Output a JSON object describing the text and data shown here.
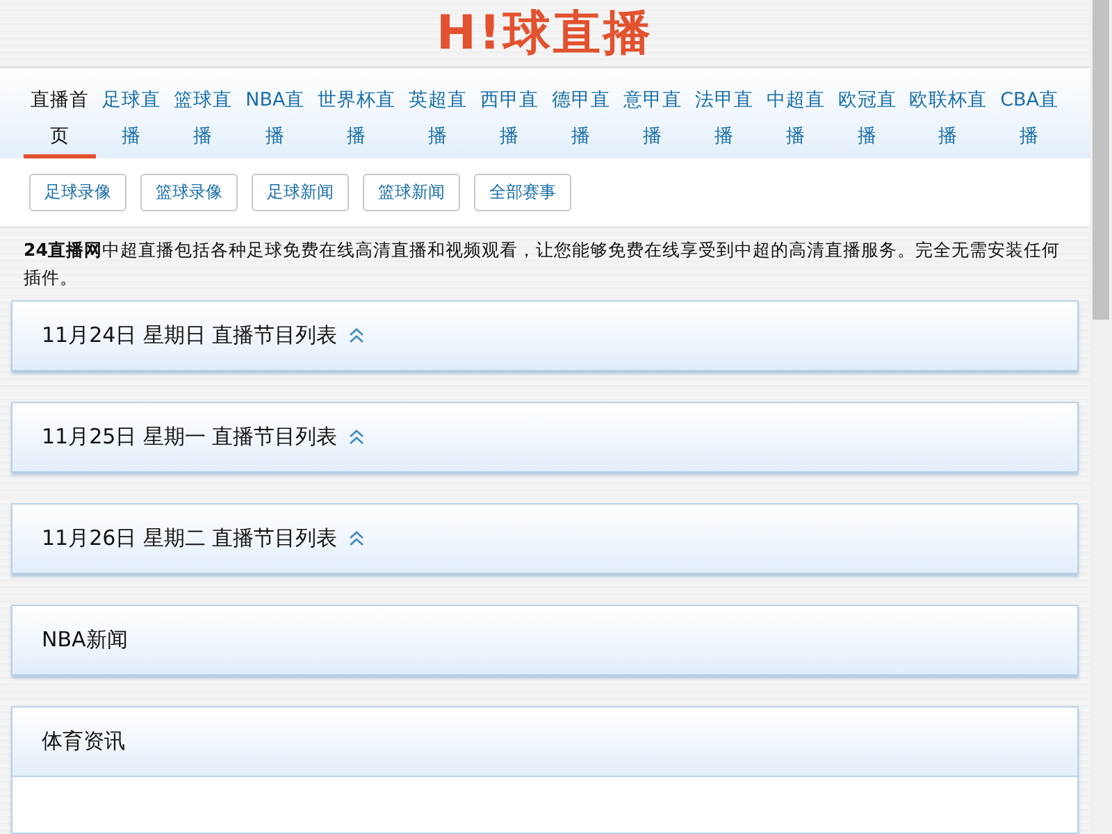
{
  "logo": "H!球直播",
  "nav": [
    {
      "label": "直播首页",
      "selected": true
    },
    {
      "label": "足球直播",
      "selected": false
    },
    {
      "label": "篮球直播",
      "selected": false
    },
    {
      "label": "NBA直播",
      "selected": false
    },
    {
      "label": "世界杯直播",
      "selected": false
    },
    {
      "label": "英超直播",
      "selected": false
    },
    {
      "label": "西甲直播",
      "selected": false
    },
    {
      "label": "德甲直播",
      "selected": false
    },
    {
      "label": "意甲直播",
      "selected": false
    },
    {
      "label": "法甲直播",
      "selected": false
    },
    {
      "label": "中超直播",
      "selected": false
    },
    {
      "label": "欧冠直播",
      "selected": false
    },
    {
      "label": "欧联杯直播",
      "selected": false
    },
    {
      "label": "CBA直播",
      "selected": false
    }
  ],
  "sub_links": [
    "足球录像",
    "篮球录像",
    "足球新闻",
    "篮球新闻",
    "全部赛事"
  ],
  "intro": "**24直播网**中超直播包括各种足球免费在线高清直播和视频观看，让您能够免费在线享受到中超的高清直播服务。完全无需安装任何插件。",
  "panels": [
    {
      "kind": "schedule",
      "title": "11月24日 星期日 直播节目列表"
    },
    {
      "kind": "schedule",
      "title": "11月25日 星期一 直播节目列表"
    },
    {
      "kind": "schedule",
      "title": "11月26日 星期二 直播节目列表"
    },
    {
      "kind": "news",
      "title": "NBA新闻"
    },
    {
      "kind": "list",
      "title": "体育资讯"
    }
  ]
}
